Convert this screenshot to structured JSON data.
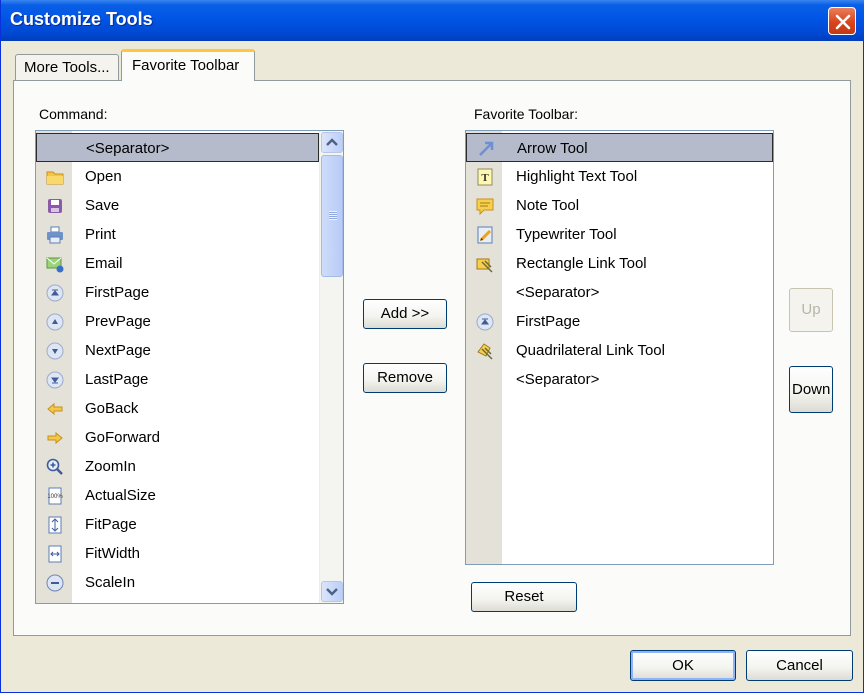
{
  "window": {
    "title": "Customize Tools"
  },
  "tabs": [
    {
      "label": "More Tools..."
    },
    {
      "label": "Favorite Toolbar"
    }
  ],
  "command_list": {
    "label": "Command:",
    "items": [
      {
        "label": "<Separator>",
        "icon": "none",
        "selected": true
      },
      {
        "label": "Open",
        "icon": "folder-icon"
      },
      {
        "label": "Save",
        "icon": "floppy-disk-icon"
      },
      {
        "label": "Print",
        "icon": "printer-icon"
      },
      {
        "label": "Email",
        "icon": "email-icon"
      },
      {
        "label": "FirstPage",
        "icon": "first-page-icon"
      },
      {
        "label": "PrevPage",
        "icon": "prev-page-icon"
      },
      {
        "label": "NextPage",
        "icon": "next-page-icon"
      },
      {
        "label": "LastPage",
        "icon": "last-page-icon"
      },
      {
        "label": "GoBack",
        "icon": "arrow-left-icon"
      },
      {
        "label": "GoForward",
        "icon": "arrow-right-icon"
      },
      {
        "label": "ZoomIn",
        "icon": "zoom-in-icon"
      },
      {
        "label": "ActualSize",
        "icon": "actual-size-icon",
        "icon_text": "100%"
      },
      {
        "label": "FitPage",
        "icon": "fit-page-icon"
      },
      {
        "label": "FitWidth",
        "icon": "fit-width-icon"
      },
      {
        "label": "ScaleIn",
        "icon": "scale-in-icon"
      }
    ]
  },
  "favorite_list": {
    "label": "Favorite Toolbar:",
    "items": [
      {
        "label": "Arrow Tool",
        "icon": "arrow-tool-icon",
        "selected": true
      },
      {
        "label": "Highlight Text Tool",
        "icon": "highlight-text-icon",
        "icon_text": "T"
      },
      {
        "label": "Note Tool",
        "icon": "note-icon"
      },
      {
        "label": "Typewriter Tool",
        "icon": "typewriter-icon"
      },
      {
        "label": "Rectangle Link Tool",
        "icon": "rectangle-link-icon"
      },
      {
        "label": "<Separator>",
        "icon": "none"
      },
      {
        "label": "FirstPage",
        "icon": "first-page-icon"
      },
      {
        "label": "Quadrilateral Link Tool",
        "icon": "quadrilateral-link-icon"
      },
      {
        "label": "<Separator>",
        "icon": "none"
      }
    ]
  },
  "buttons": {
    "add": "Add >>",
    "remove": "Remove",
    "up": "Up",
    "down": "Down",
    "reset": "Reset",
    "ok": "OK",
    "cancel": "Cancel"
  },
  "colors": {
    "titlebar": "#0055e5",
    "selection": "#b5bbcb",
    "tab_highlight": "#ffc73c",
    "icon_gutter": "#e3e1d8"
  }
}
